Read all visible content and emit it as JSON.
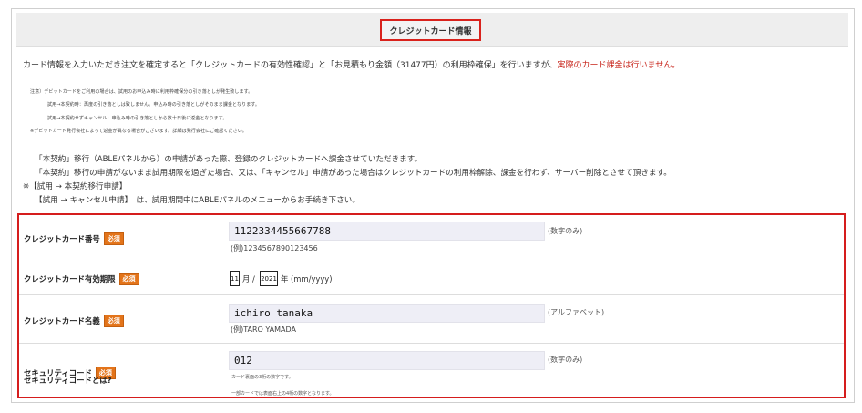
{
  "section": {
    "title": "クレジットカード情報"
  },
  "intro": {
    "part1": "カード情報を入力いただき注文を確定すると「クレジットカードの有効性確認」と「お見積もり金額（31477円）の利用枠確保」を行いますが、",
    "part2": "実際のカード課金は行いません。"
  },
  "notes": [
    "注意）デビットカードをご利用の場合は、試用のお申込み時に利用枠確保分の引き落としが発生致します。",
    "試用→本契約時：再度の引き落としは致しません。申込み時の引き落としがそのまま課金となります。",
    "試用→本契約せずキャンセル：申込み時の引き落としから数十日後に返金となります。",
    "※デビットカード発行会社によって返金が異なる場合がございます。詳細は発行会社にご確認ください。"
  ],
  "messages": [
    "「本契約」移行（ABLEパネルから）の申請があった際、登録のクレジットカードへ課金させていただきます。",
    "「本契約」移行の申請がないまま試用期限を過ぎた場合、又は、「キャンセル」申請があった場合はクレジットカードの利用枠解除、課金を行わず、サーバー削除とさせて頂きます。",
    "※【試用 → 本契約移行申請】",
    "【試用 → キャンセル申請】　は、試用期間中にABLEパネルのメニューからお手続き下さい。"
  ],
  "required_badge": "必須",
  "form": {
    "card_number": {
      "label": "クレジットカード番号",
      "value": "1122334455667788",
      "example": "(例)1234567890123456",
      "hint": "(数字のみ)"
    },
    "expiry": {
      "label": "クレジットカード有効期限",
      "month": "11",
      "month_unit": "月 /",
      "year": "2021",
      "year_unit": "年 (mm/yyyy)"
    },
    "card_name": {
      "label": "クレジットカード名義",
      "value": "ichiro tanaka",
      "example": "(例)TARO YAMADA",
      "hint": "(アルファベット)"
    },
    "security_code": {
      "label": "セキュリティコード",
      "link": "セキュリティコードとは?",
      "value": "012",
      "hint": "(数字のみ)",
      "note1": "カード裏面の3桁の数字です。",
      "note2": "一部カードでは表面右上の4桁の数字となります。"
    }
  },
  "colors": {
    "highlight": "#d51d1d",
    "badge": "#e3741a",
    "input_bg": "#eeeef6"
  }
}
